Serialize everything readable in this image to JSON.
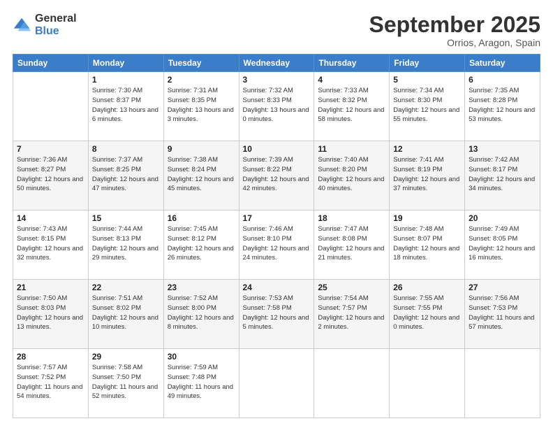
{
  "logo": {
    "general": "General",
    "blue": "Blue"
  },
  "header": {
    "month": "September 2025",
    "location": "Orrios, Aragon, Spain"
  },
  "weekdays": [
    "Sunday",
    "Monday",
    "Tuesday",
    "Wednesday",
    "Thursday",
    "Friday",
    "Saturday"
  ],
  "weeks": [
    [
      {
        "day": "",
        "sunrise": "",
        "sunset": "",
        "daylight": ""
      },
      {
        "day": "1",
        "sunrise": "Sunrise: 7:30 AM",
        "sunset": "Sunset: 8:37 PM",
        "daylight": "Daylight: 13 hours and 6 minutes."
      },
      {
        "day": "2",
        "sunrise": "Sunrise: 7:31 AM",
        "sunset": "Sunset: 8:35 PM",
        "daylight": "Daylight: 13 hours and 3 minutes."
      },
      {
        "day": "3",
        "sunrise": "Sunrise: 7:32 AM",
        "sunset": "Sunset: 8:33 PM",
        "daylight": "Daylight: 13 hours and 0 minutes."
      },
      {
        "day": "4",
        "sunrise": "Sunrise: 7:33 AM",
        "sunset": "Sunset: 8:32 PM",
        "daylight": "Daylight: 12 hours and 58 minutes."
      },
      {
        "day": "5",
        "sunrise": "Sunrise: 7:34 AM",
        "sunset": "Sunset: 8:30 PM",
        "daylight": "Daylight: 12 hours and 55 minutes."
      },
      {
        "day": "6",
        "sunrise": "Sunrise: 7:35 AM",
        "sunset": "Sunset: 8:28 PM",
        "daylight": "Daylight: 12 hours and 53 minutes."
      }
    ],
    [
      {
        "day": "7",
        "sunrise": "Sunrise: 7:36 AM",
        "sunset": "Sunset: 8:27 PM",
        "daylight": "Daylight: 12 hours and 50 minutes."
      },
      {
        "day": "8",
        "sunrise": "Sunrise: 7:37 AM",
        "sunset": "Sunset: 8:25 PM",
        "daylight": "Daylight: 12 hours and 47 minutes."
      },
      {
        "day": "9",
        "sunrise": "Sunrise: 7:38 AM",
        "sunset": "Sunset: 8:24 PM",
        "daylight": "Daylight: 12 hours and 45 minutes."
      },
      {
        "day": "10",
        "sunrise": "Sunrise: 7:39 AM",
        "sunset": "Sunset: 8:22 PM",
        "daylight": "Daylight: 12 hours and 42 minutes."
      },
      {
        "day": "11",
        "sunrise": "Sunrise: 7:40 AM",
        "sunset": "Sunset: 8:20 PM",
        "daylight": "Daylight: 12 hours and 40 minutes."
      },
      {
        "day": "12",
        "sunrise": "Sunrise: 7:41 AM",
        "sunset": "Sunset: 8:19 PM",
        "daylight": "Daylight: 12 hours and 37 minutes."
      },
      {
        "day": "13",
        "sunrise": "Sunrise: 7:42 AM",
        "sunset": "Sunset: 8:17 PM",
        "daylight": "Daylight: 12 hours and 34 minutes."
      }
    ],
    [
      {
        "day": "14",
        "sunrise": "Sunrise: 7:43 AM",
        "sunset": "Sunset: 8:15 PM",
        "daylight": "Daylight: 12 hours and 32 minutes."
      },
      {
        "day": "15",
        "sunrise": "Sunrise: 7:44 AM",
        "sunset": "Sunset: 8:13 PM",
        "daylight": "Daylight: 12 hours and 29 minutes."
      },
      {
        "day": "16",
        "sunrise": "Sunrise: 7:45 AM",
        "sunset": "Sunset: 8:12 PM",
        "daylight": "Daylight: 12 hours and 26 minutes."
      },
      {
        "day": "17",
        "sunrise": "Sunrise: 7:46 AM",
        "sunset": "Sunset: 8:10 PM",
        "daylight": "Daylight: 12 hours and 24 minutes."
      },
      {
        "day": "18",
        "sunrise": "Sunrise: 7:47 AM",
        "sunset": "Sunset: 8:08 PM",
        "daylight": "Daylight: 12 hours and 21 minutes."
      },
      {
        "day": "19",
        "sunrise": "Sunrise: 7:48 AM",
        "sunset": "Sunset: 8:07 PM",
        "daylight": "Daylight: 12 hours and 18 minutes."
      },
      {
        "day": "20",
        "sunrise": "Sunrise: 7:49 AM",
        "sunset": "Sunset: 8:05 PM",
        "daylight": "Daylight: 12 hours and 16 minutes."
      }
    ],
    [
      {
        "day": "21",
        "sunrise": "Sunrise: 7:50 AM",
        "sunset": "Sunset: 8:03 PM",
        "daylight": "Daylight: 12 hours and 13 minutes."
      },
      {
        "day": "22",
        "sunrise": "Sunrise: 7:51 AM",
        "sunset": "Sunset: 8:02 PM",
        "daylight": "Daylight: 12 hours and 10 minutes."
      },
      {
        "day": "23",
        "sunrise": "Sunrise: 7:52 AM",
        "sunset": "Sunset: 8:00 PM",
        "daylight": "Daylight: 12 hours and 8 minutes."
      },
      {
        "day": "24",
        "sunrise": "Sunrise: 7:53 AM",
        "sunset": "Sunset: 7:58 PM",
        "daylight": "Daylight: 12 hours and 5 minutes."
      },
      {
        "day": "25",
        "sunrise": "Sunrise: 7:54 AM",
        "sunset": "Sunset: 7:57 PM",
        "daylight": "Daylight: 12 hours and 2 minutes."
      },
      {
        "day": "26",
        "sunrise": "Sunrise: 7:55 AM",
        "sunset": "Sunset: 7:55 PM",
        "daylight": "Daylight: 12 hours and 0 minutes."
      },
      {
        "day": "27",
        "sunrise": "Sunrise: 7:56 AM",
        "sunset": "Sunset: 7:53 PM",
        "daylight": "Daylight: 11 hours and 57 minutes."
      }
    ],
    [
      {
        "day": "28",
        "sunrise": "Sunrise: 7:57 AM",
        "sunset": "Sunset: 7:52 PM",
        "daylight": "Daylight: 11 hours and 54 minutes."
      },
      {
        "day": "29",
        "sunrise": "Sunrise: 7:58 AM",
        "sunset": "Sunset: 7:50 PM",
        "daylight": "Daylight: 11 hours and 52 minutes."
      },
      {
        "day": "30",
        "sunrise": "Sunrise: 7:59 AM",
        "sunset": "Sunset: 7:48 PM",
        "daylight": "Daylight: 11 hours and 49 minutes."
      },
      {
        "day": "",
        "sunrise": "",
        "sunset": "",
        "daylight": ""
      },
      {
        "day": "",
        "sunrise": "",
        "sunset": "",
        "daylight": ""
      },
      {
        "day": "",
        "sunrise": "",
        "sunset": "",
        "daylight": ""
      },
      {
        "day": "",
        "sunrise": "",
        "sunset": "",
        "daylight": ""
      }
    ]
  ]
}
